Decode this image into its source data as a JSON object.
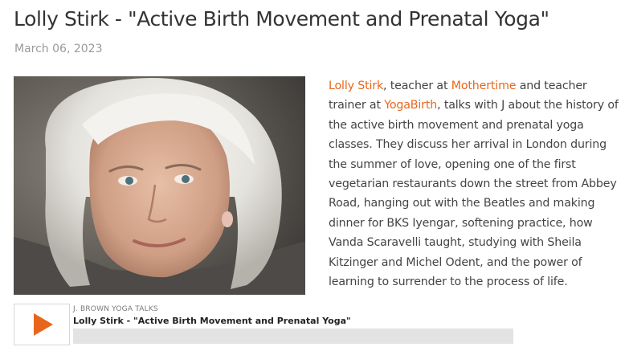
{
  "post": {
    "title": "Lolly Stirk - \"Active Birth Movement and Prenatal Yoga\"",
    "date": "March 06, 2023"
  },
  "description": {
    "link_lolly": "Lolly Stirk",
    "text_1": ", teacher at ",
    "link_mothertime": "Mothertime",
    "text_2": " and teacher trainer at ",
    "link_yogabirth": "YogaBirth",
    "text_3": ", talks with J about the history of the active birth movement and prenatal yoga classes. They discuss her arrival in London during the summer of love, opening one of the first vegetarian restaurants down the street from Abbey Road, hanging out with the Beatles and making dinner for BKS Iyengar, softening practice, how Vanda Scaravelli taught, studying with Sheila Kitzinger and Michel Odent, and the power of learning to surrender to the process of life."
  },
  "player": {
    "show_name": "J. BROWN YOGA TALKS",
    "episode_title": "Lolly Stirk - \"Active Birth Movement and Prenatal Yoga\"",
    "play_icon": "play-icon",
    "progress": 0
  },
  "colors": {
    "accent": "#e8661c",
    "text": "#444444",
    "muted": "#9a9a9a",
    "progress_track": "#e3e3e3"
  }
}
